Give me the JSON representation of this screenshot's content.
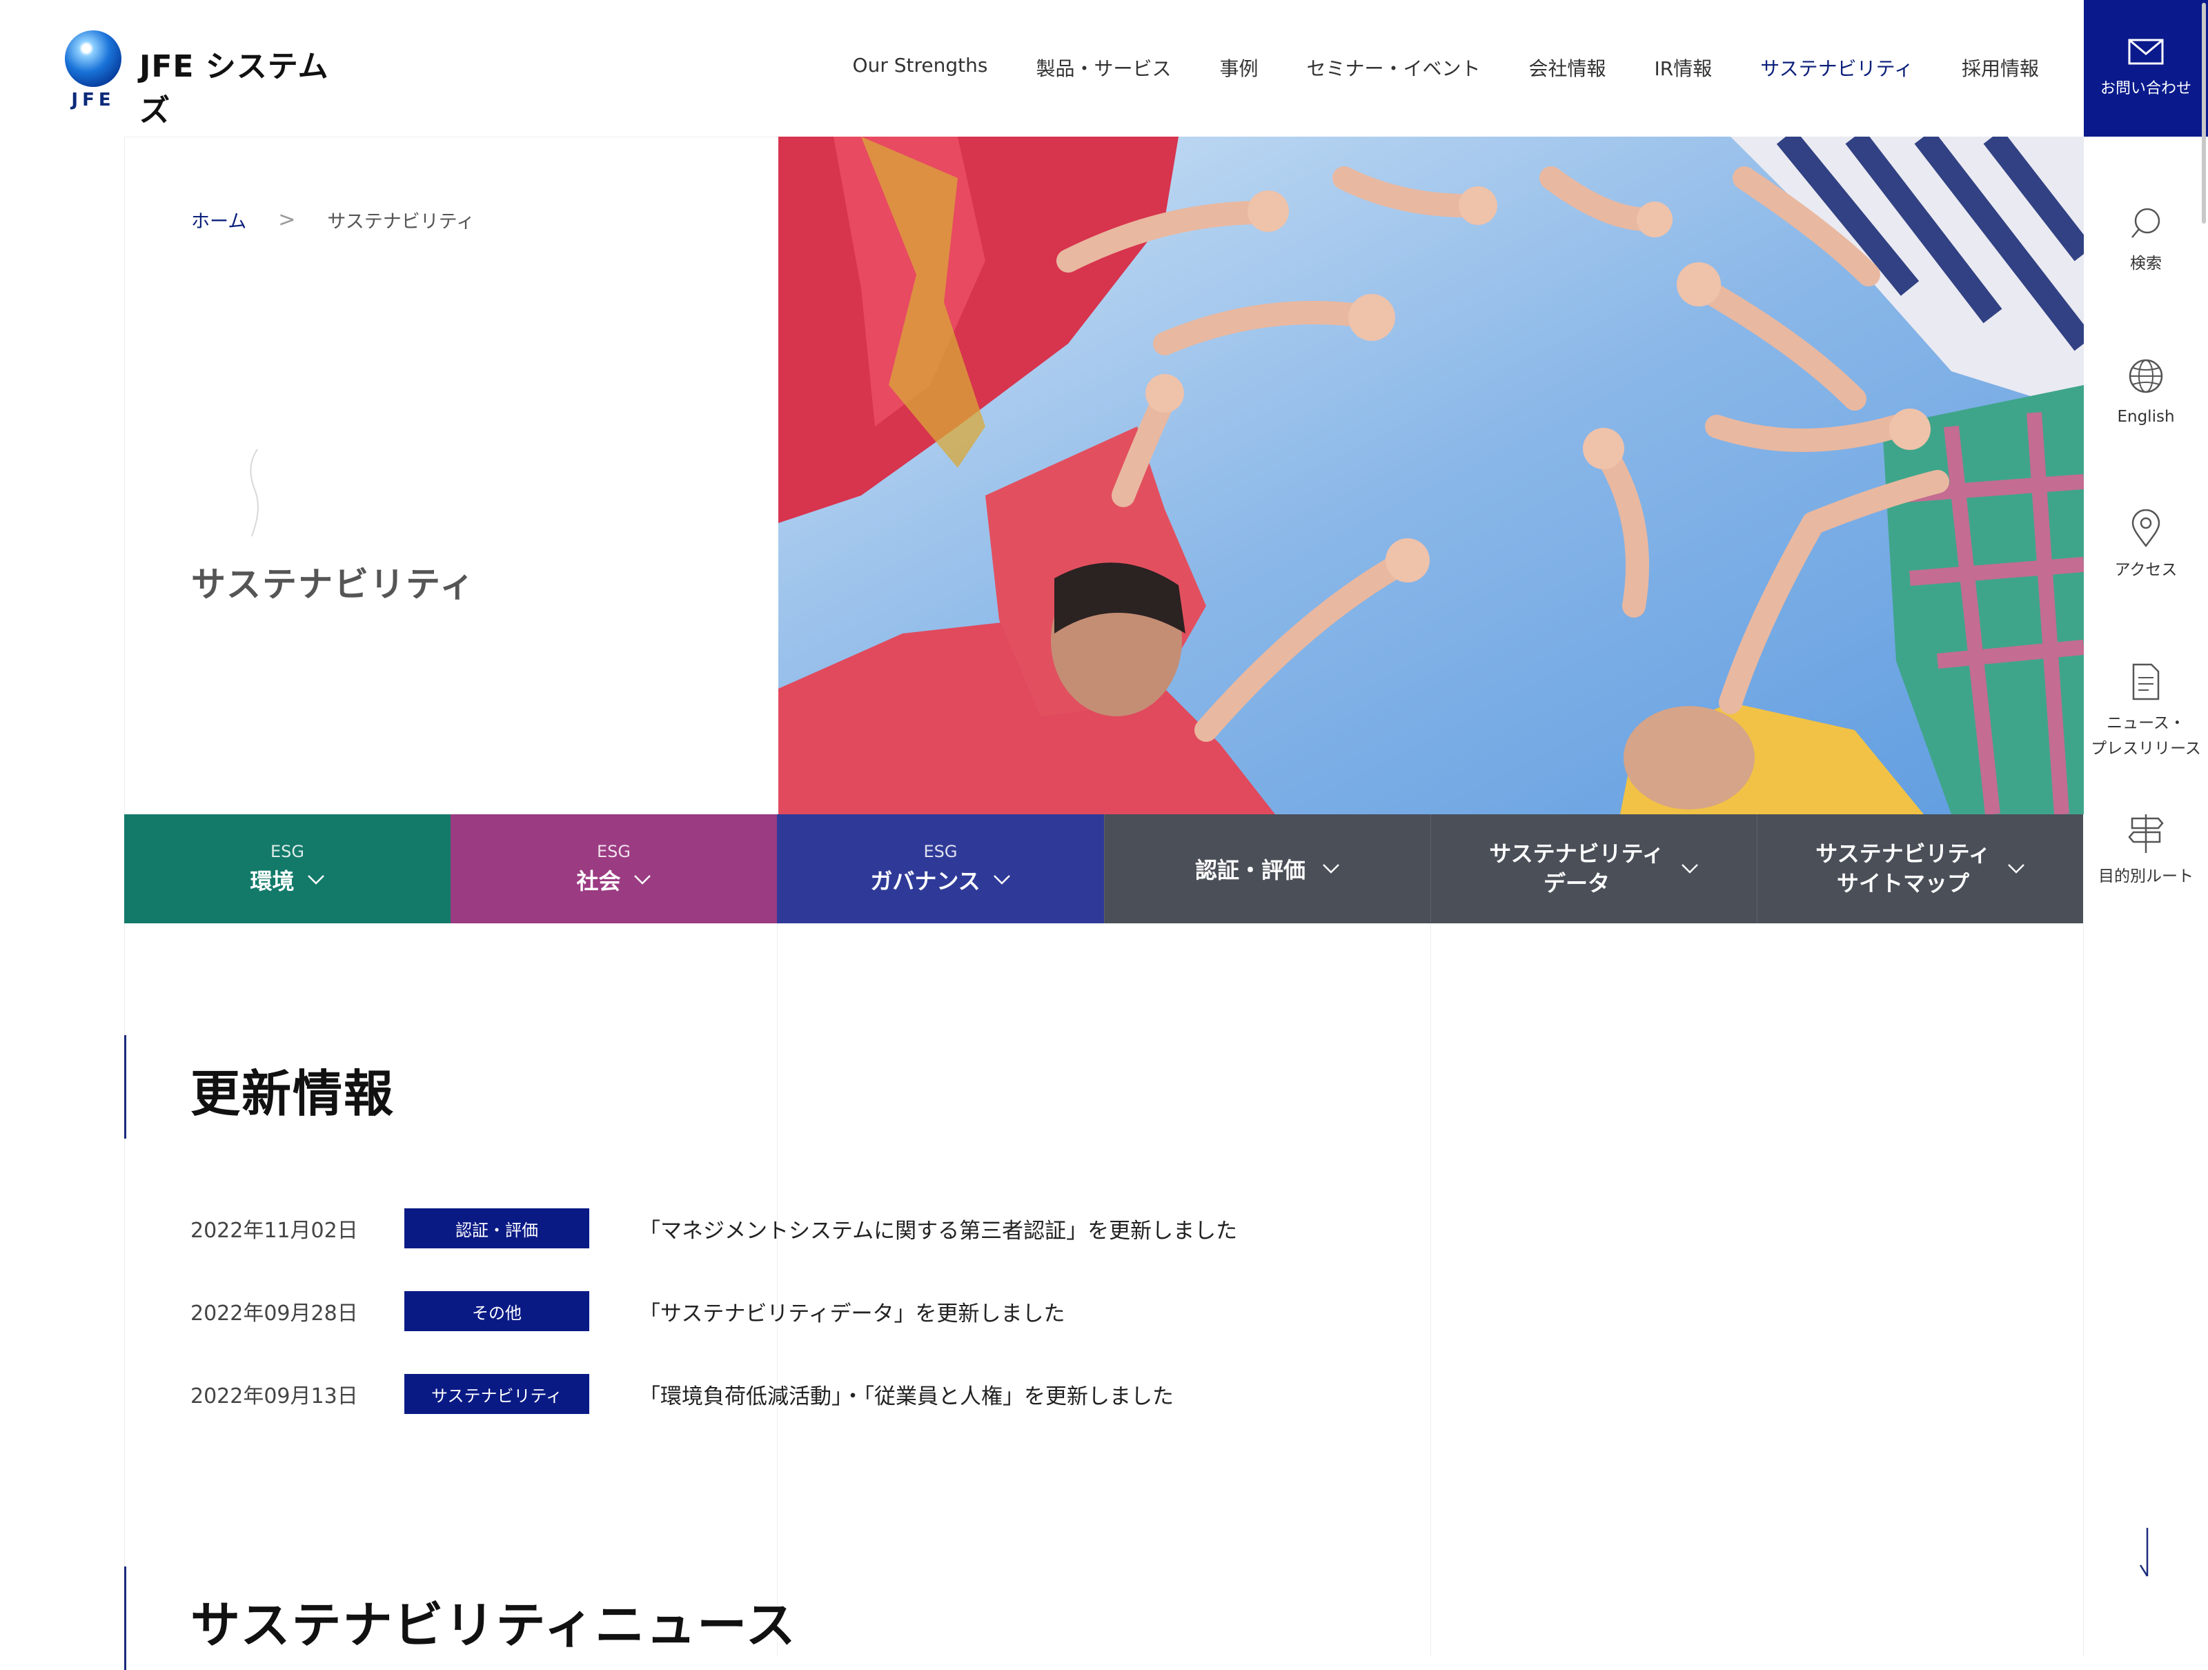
{
  "header": {
    "logo_text": "JFE システムズ",
    "logo_mark": "JFE",
    "nav": [
      "Our Strengths",
      "製品・サービス",
      "事例",
      "セミナー・イベント",
      "会社情報",
      "IR情報",
      "サステナビリティ",
      "採用情報"
    ],
    "active_nav": "サステナビリティ",
    "contact_label": "お問い合わせ"
  },
  "sidebar": {
    "search": "検索",
    "english": "English",
    "access": "アクセス",
    "news": "ニュース・\nプレスリリース",
    "route": "目的別ルート"
  },
  "breadcrumb": {
    "home": "ホーム",
    "separator": ">",
    "current": "サステナビリティ"
  },
  "hero": {
    "title": "サステナビリティ"
  },
  "categories": {
    "env": {
      "sub": "ESG",
      "label": "環境",
      "color": "#137a6a"
    },
    "soc": {
      "sub": "ESG",
      "label": "社会",
      "color": "#9b3b82"
    },
    "gov": {
      "sub": "ESG",
      "label": "ガバナンス",
      "color": "#2f3a98"
    },
    "cert": {
      "label": "認証・評価"
    },
    "data": {
      "line1": "サステナビリティ",
      "line2": "データ"
    },
    "sitemap": {
      "line1": "サステナビリティ",
      "line2": "サイトマップ"
    }
  },
  "updates": {
    "heading": "更新情報",
    "items": [
      {
        "date": "2022年11月02日",
        "tag": "認証・評価",
        "text": "「マネジメントシステムに関する第三者認証」を更新しました"
      },
      {
        "date": "2022年09月28日",
        "tag": "その他",
        "text": "「サステナビリティデータ」を更新しました"
      },
      {
        "date": "2022年09月13日",
        "tag": "サステナビリティ",
        "text": "「環境負荷低減活動」・「従業員と人権」を更新しました"
      }
    ]
  },
  "news_section": {
    "heading": "サステナビリティニュース"
  },
  "colors": {
    "brand_navy": "#0a1a8c",
    "tag_navy": "#0a1a85"
  }
}
